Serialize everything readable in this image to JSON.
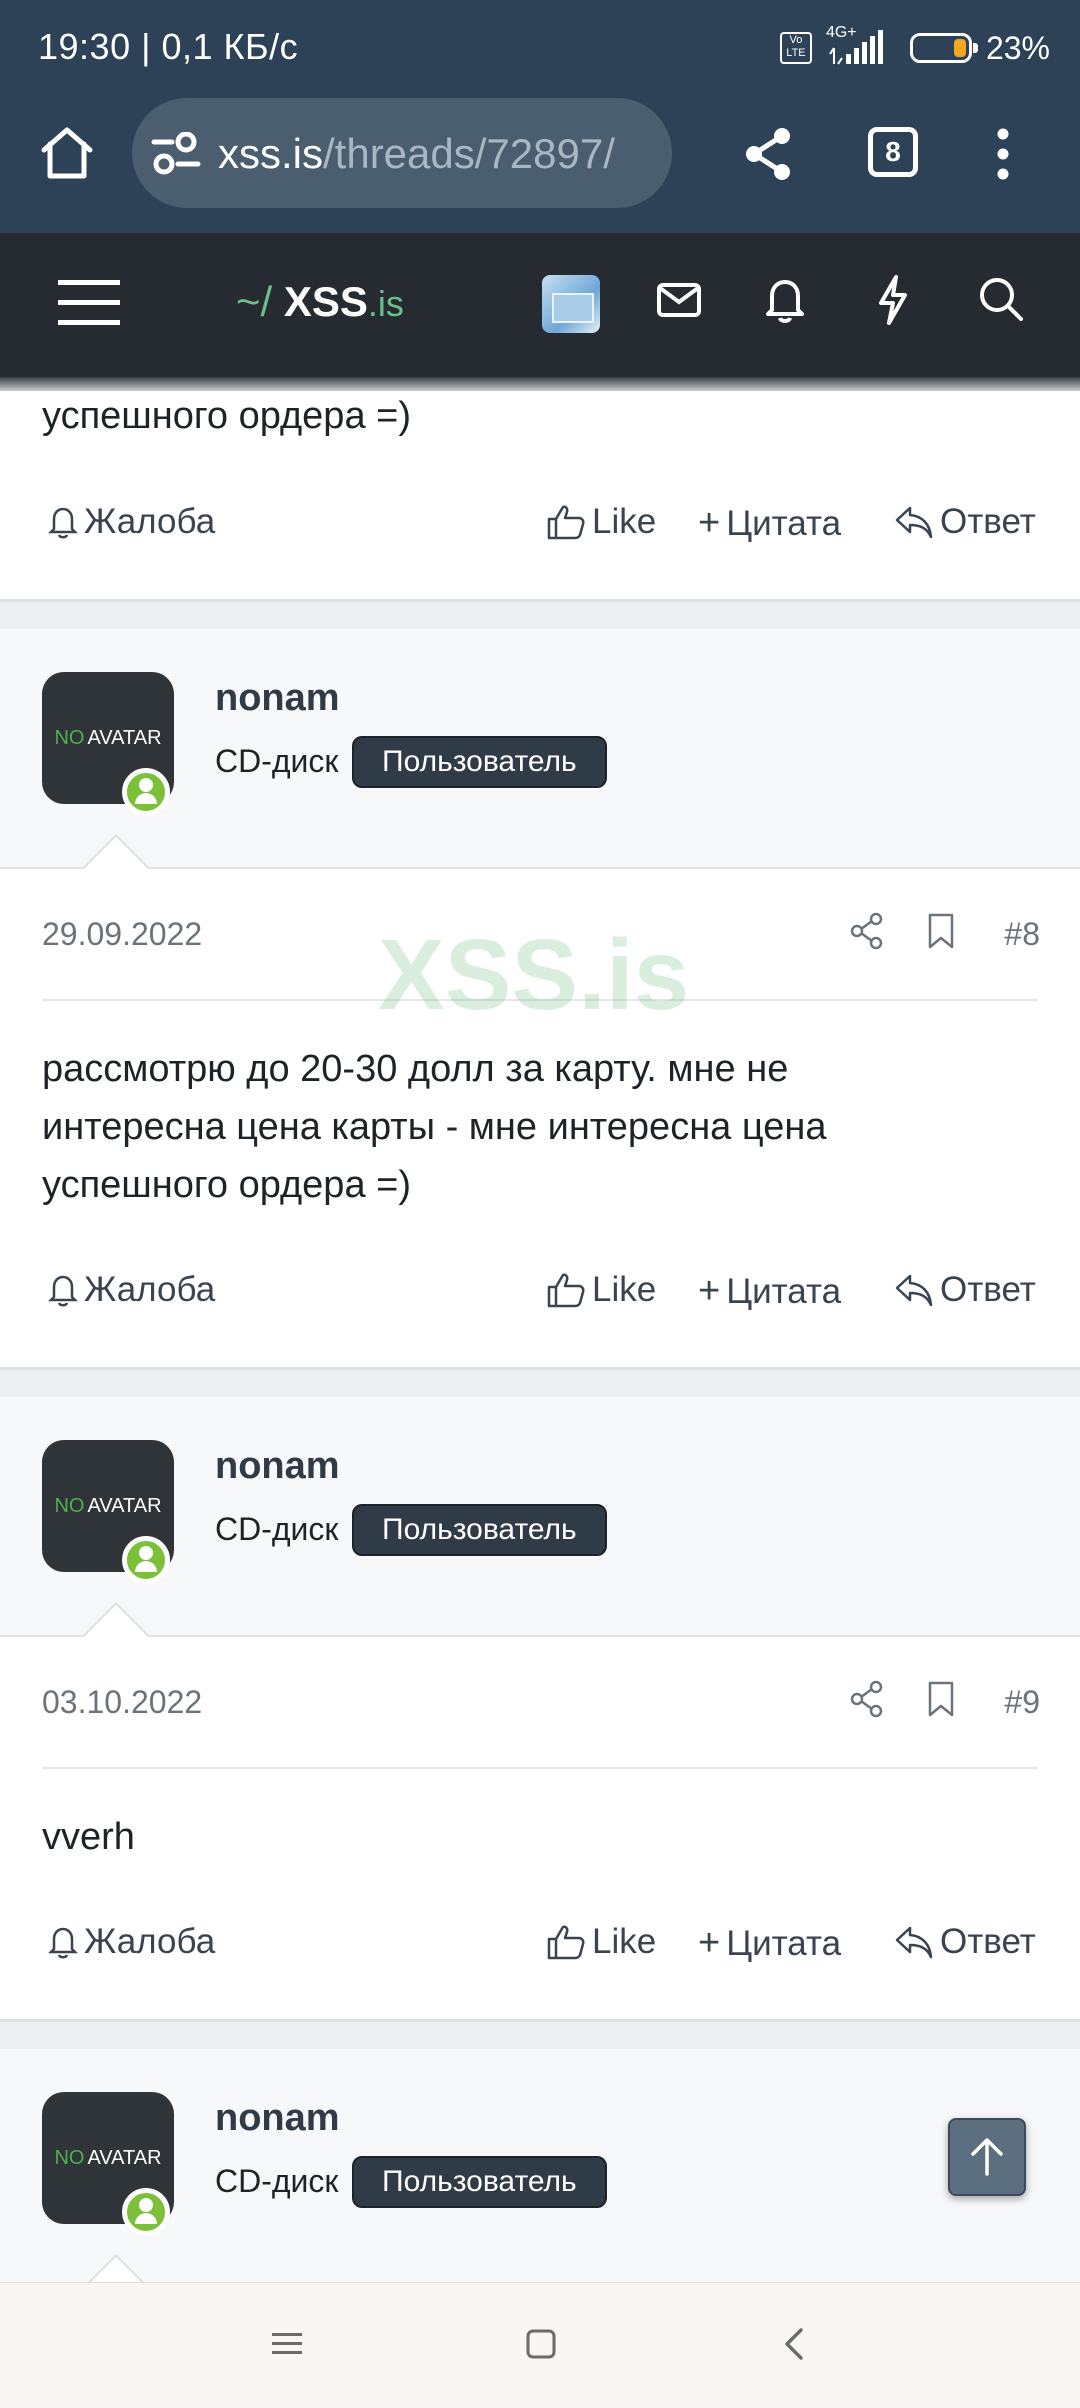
{
  "status_bar": {
    "time": "19:30 | 0,1 КБ/с",
    "network": "4G+",
    "volte": "Vo LTE",
    "battery": "23%"
  },
  "browser": {
    "url_host": "xss.is",
    "url_path": "/threads/72897/",
    "tab_count": "8",
    "icons": [
      "home-icon",
      "site-settings-icon",
      "share-icon",
      "tab-switcher-icon",
      "overflow-menu-icon"
    ]
  },
  "site": {
    "logo_prefix": "~/ ",
    "logo_name": "XSS",
    "logo_tld": ".is",
    "icons": [
      "hamburger-menu-icon",
      "user-avatar",
      "mail-icon",
      "bell-icon",
      "lightning-icon",
      "search-icon"
    ]
  },
  "watermark": "XSS.is",
  "actions": {
    "report": "Жалоба",
    "like": "Like",
    "quote": "Цитата",
    "reply": "Ответ"
  },
  "top_partial_post": {
    "text_tail": "успешного ордера =)"
  },
  "posts": [
    {
      "avatar_no": "NO",
      "avatar_text": "AVATAR",
      "username": "nonam",
      "user_title": "CD-диск",
      "user_badge": "Пользователь",
      "date": "29.09.2022",
      "number": "#8",
      "text_lines": [
        "рассмотрю до 20-30 долл за карту. мне не",
        "интересна цена карты - мне интересна цена",
        "успешного ордера =)"
      ]
    },
    {
      "avatar_no": "NO",
      "avatar_text": "AVATAR",
      "username": "nonam",
      "user_title": "CD-диск",
      "user_badge": "Пользователь",
      "date": "03.10.2022",
      "number": "#9",
      "text_lines": [
        "vverh"
      ]
    },
    {
      "avatar_no": "NO",
      "avatar_text": "AVATAR",
      "username": "nonam",
      "user_title": "CD-диск",
      "user_badge": "Пользователь"
    }
  ]
}
